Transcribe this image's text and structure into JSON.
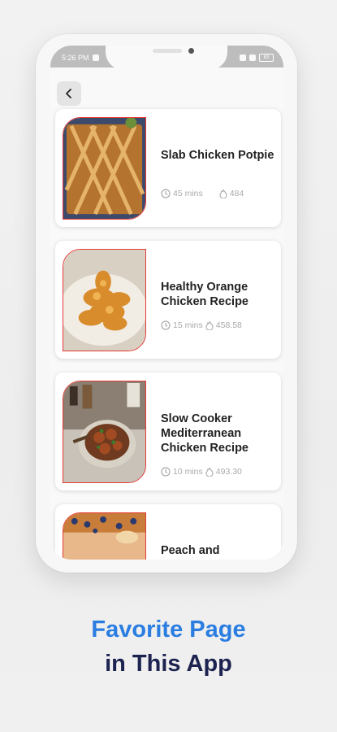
{
  "status_bar": {
    "time": "5:26 PM",
    "battery": "83"
  },
  "back_button": {
    "icon": "chevron-left-icon"
  },
  "recipes": [
    {
      "title": "Slab Chicken Potpie",
      "time": "45 mins",
      "calories": "484"
    },
    {
      "title": "Healthy Orange Chicken Recipe",
      "time": "15 mins",
      "calories": "458.58"
    },
    {
      "title": "Slow Cooker Mediterranean Chicken Recipe",
      "time": "10 mins",
      "calories": "493.30"
    },
    {
      "title": "Peach and",
      "time": "",
      "calories": ""
    }
  ],
  "caption": {
    "line1": "Favorite Page",
    "line2": "in This App"
  },
  "colors": {
    "accent_blue": "#2a7de1",
    "caption_dark": "#1d2350",
    "thumb_border": "#e53935"
  }
}
